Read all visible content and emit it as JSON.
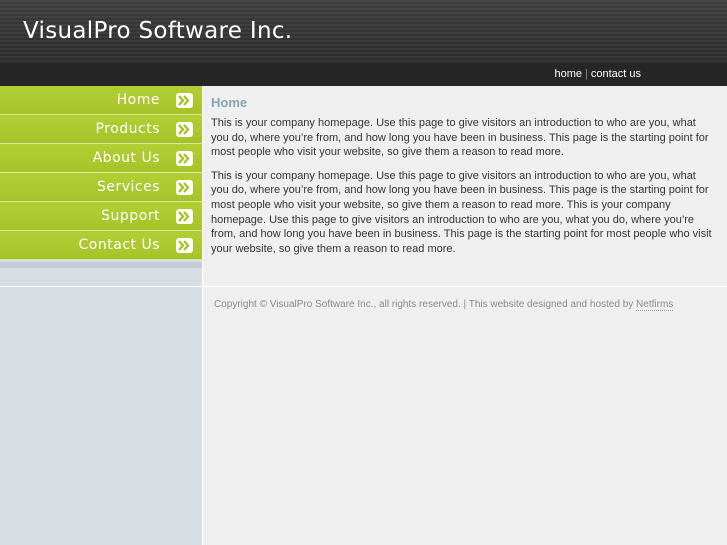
{
  "header": {
    "site_title": "VisualPro Software Inc.",
    "links": [
      {
        "label": "home"
      },
      {
        "label": "contact us"
      }
    ],
    "separator": "|"
  },
  "nav": {
    "items": [
      {
        "label": "Home",
        "icon": "double-chevron-right-icon"
      },
      {
        "label": "Products",
        "icon": "double-chevron-right-icon"
      },
      {
        "label": "About Us",
        "icon": "double-chevron-right-icon"
      },
      {
        "label": "Services",
        "icon": "double-chevron-right-icon"
      },
      {
        "label": "Support",
        "icon": "double-chevron-right-icon"
      },
      {
        "label": "Contact Us",
        "icon": "double-chevron-right-icon"
      }
    ]
  },
  "main": {
    "title": "Home",
    "paragraphs": [
      "This is your company homepage. Use this page to give visitors an introduction to who are you, what you do, where you’re from, and how long you have been in business. This page is the starting point for most people who visit your website, so give them a reason to read more.",
      "This is your company homepage. Use this page to give visitors an introduction to who are you, what you do, where you’re from, and how long you have been in business. This page is the starting point for most people who visit your website, so give them a reason to read more. This is your company homepage. Use this page to give visitors an introduction to who are you, what you do, where you’re from, and how long you have been in business. This page is the starting point for most people who visit your website, so give them a reason to read more."
    ]
  },
  "footer": {
    "text": "Copyright © VisualPro Software Inc., all rights reserved. | This website designed and hosted by ",
    "link_label": "Netfirms"
  },
  "colors": {
    "nav_green": "#b2cf34",
    "header_dark": "#2e2e2e",
    "sidebar_blue_gray": "#d6dee3",
    "title_blue": "#8aa2b4",
    "page_bg": "#efefef"
  }
}
